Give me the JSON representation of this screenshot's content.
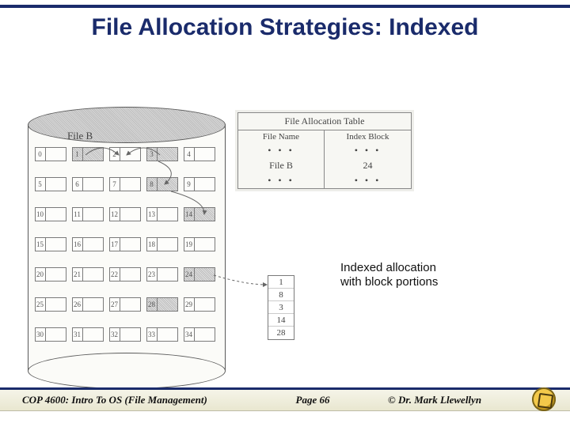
{
  "title": "File Allocation Strategies: Indexed",
  "fileb_label": "File B",
  "cells": {
    "r1": [
      "0",
      "1",
      "2",
      "3",
      "4"
    ],
    "r2": [
      "5",
      "6",
      "7",
      "8",
      "9"
    ],
    "r3": [
      "10",
      "11",
      "12",
      "13",
      "14"
    ],
    "r4": [
      "15",
      "16",
      "17",
      "18",
      "19"
    ],
    "r5": [
      "20",
      "21",
      "22",
      "23",
      "24"
    ],
    "r6": [
      "25",
      "26",
      "27",
      "28",
      "29"
    ],
    "r7": [
      "30",
      "31",
      "32",
      "33",
      "34"
    ]
  },
  "fat": {
    "title": "File Allocation Table",
    "head_left": "File Name",
    "head_right": "Index Block",
    "dots": "• • •",
    "file": "File B",
    "index": "24"
  },
  "idx": {
    "v1": "1",
    "v2": "8",
    "v3": "3",
    "v4": "14",
    "v5": "28"
  },
  "caption_l1": "Indexed allocation",
  "caption_l2": "with block portions",
  "footer": {
    "left": "COP 4600: Intro To OS  (File Management)",
    "mid": "Page 66",
    "right": "© Dr. Mark Llewellyn"
  }
}
